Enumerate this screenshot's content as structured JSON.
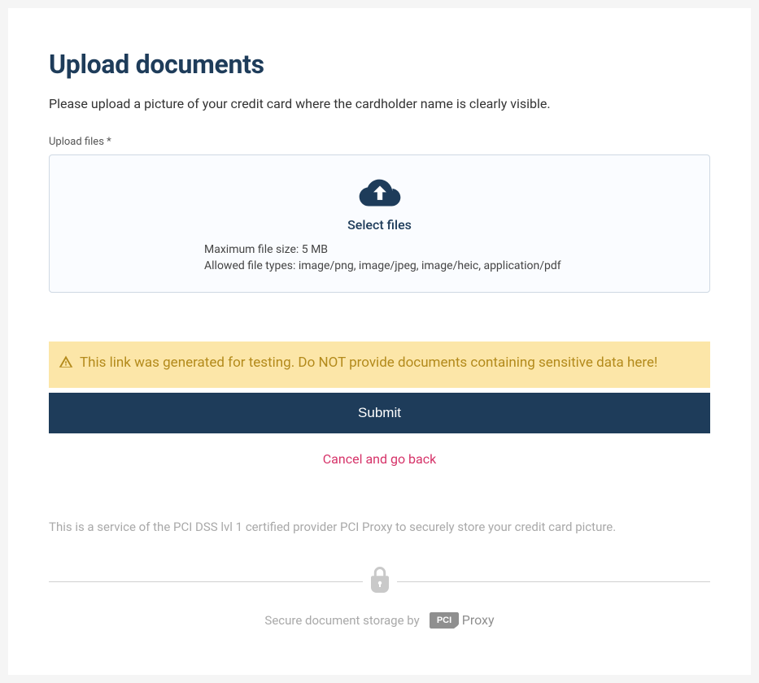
{
  "page": {
    "title": "Upload documents",
    "description": "Please upload a picture of your credit card where the cardholder name is clearly visible."
  },
  "upload": {
    "label": "Upload files *",
    "select_label": "Select files",
    "max_size_line": "Maximum file size: 5 MB",
    "allowed_types_line": "Allowed file types: image/png, image/jpeg, image/heic, application/pdf"
  },
  "warning": {
    "text": "This link was generated for testing. Do NOT provide documents containing sensitive data here!"
  },
  "actions": {
    "submit_label": "Submit",
    "cancel_label": "Cancel and go back"
  },
  "footer": {
    "disclaimer": "This is a service of the PCI DSS lvl 1 certified provider PCI Proxy to securely store your credit card picture.",
    "storage_by": "Secure document storage by",
    "brand_pci": "PCI",
    "brand_proxy": "Proxy"
  }
}
